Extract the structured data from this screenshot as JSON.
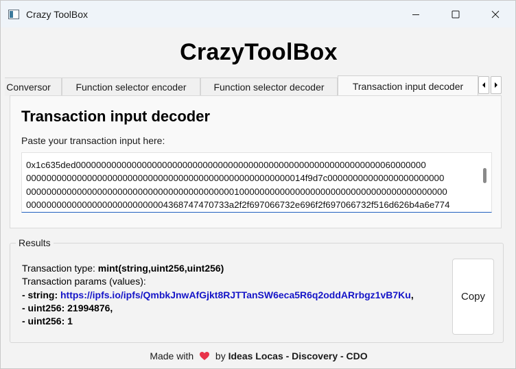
{
  "window": {
    "title": "Crazy ToolBox"
  },
  "app": {
    "title": "CrazyToolBox"
  },
  "tabs": [
    {
      "label": "Conversor"
    },
    {
      "label": "Function selector encoder"
    },
    {
      "label": "Function selector decoder"
    },
    {
      "label": "Transaction input decoder"
    }
  ],
  "panel": {
    "heading": "Transaction input decoder",
    "paste_label": "Paste your transaction input here:",
    "input_lines": [
      "0x1c635ded000000000000000000000000000000000000000000000000000000000000060000000",
      "0000000000000000000000000000000000000000000000000000014f9d7c00000000000000000000000",
      "00000000000000000000000000000000000000000100000000000000000000000000000000000000000",
      "0000000000000000000000000004368747470733a2f2f697066732e696f2f697066732f516d626b4a6e774"
    ]
  },
  "results": {
    "legend": "Results",
    "type_label": "Transaction type: ",
    "type_value": "mint(string,uint256,uint256)",
    "params_label": "Transaction params (values):",
    "param1_prefix": "- string: ",
    "param1_value": "https://ipfs.io/ipfs/QmbkJnwAfGjkt8RJTTanSW6eca5R6q2oddARrbgz1vB7Ku",
    "param1_suffix": ",",
    "param2": "- uint256: 21994876,",
    "param3": "- uint256: 1",
    "copy_label": "Copy"
  },
  "footer": {
    "prefix": "Made with",
    "by": "by",
    "author": "Ideas Locas - Discovery - CDO"
  },
  "colors": {
    "link": "#1515c8",
    "heart": "#e8334a",
    "input_focus": "#1f5fbf"
  },
  "icons": [
    "app-icon",
    "minimize-icon",
    "maximize-icon",
    "close-icon",
    "arrow-left-icon",
    "arrow-right-icon",
    "heart-icon"
  ]
}
